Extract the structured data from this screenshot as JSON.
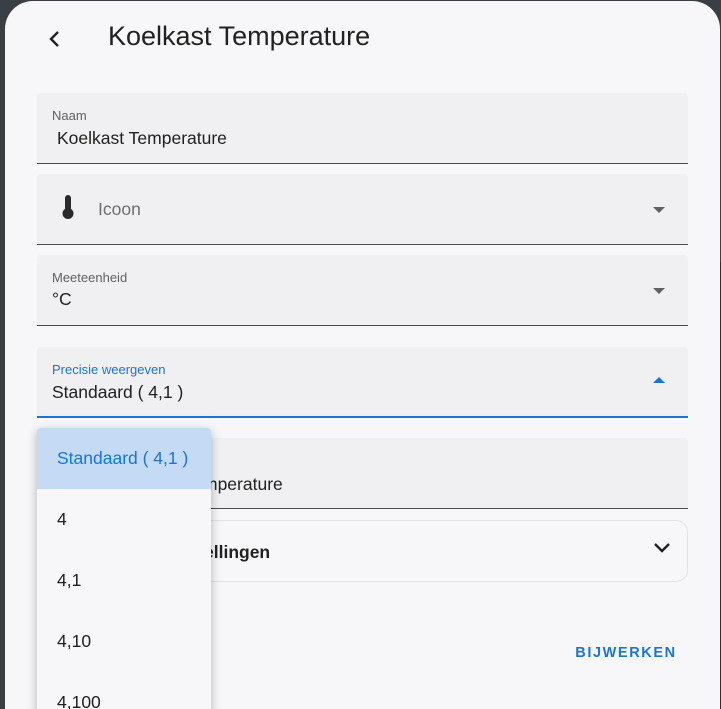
{
  "dialog": {
    "title": "Koelkast Temperature",
    "back_icon": "chevron-left-icon"
  },
  "fields": {
    "name": {
      "label": "Naam",
      "value": "Koelkast Temperature"
    },
    "icon": {
      "placeholder": "Icoon",
      "icon": "thermometer-icon"
    },
    "unit": {
      "label": "Meeteenheid",
      "value": "°C"
    },
    "precision": {
      "label": "Precisie weergeven",
      "value": "Standaard ( 4,1 )"
    },
    "hidden_value_visible": "mperature"
  },
  "precision_menu": {
    "options": [
      "Standaard ( 4,1 )",
      "4",
      "4,1",
      "4,10",
      "4,100"
    ],
    "selected_index": 0
  },
  "advanced": {
    "label_visible": "ellingen"
  },
  "actions": {
    "update_label": "BIJWERKEN"
  },
  "colors": {
    "accent": "#1976d2",
    "selected_bg": "#c5daf4"
  }
}
